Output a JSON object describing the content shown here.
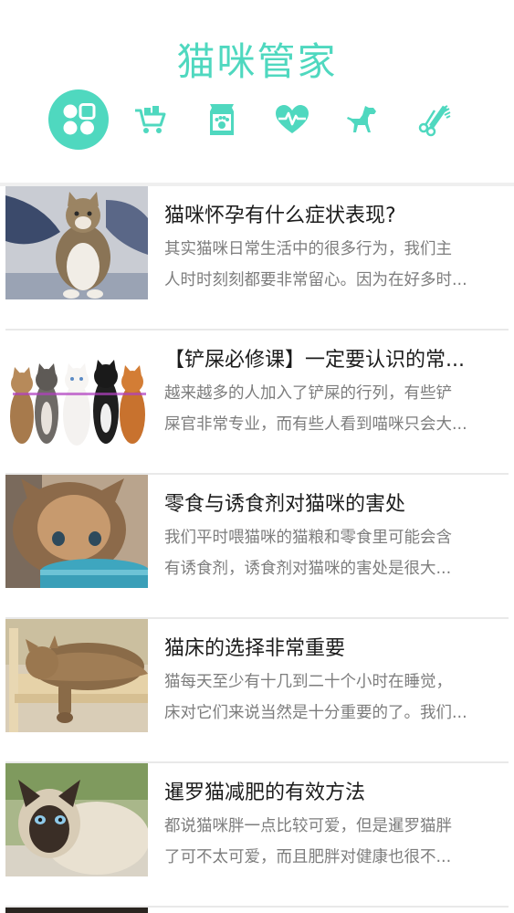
{
  "app": {
    "title": "猫咪管家"
  },
  "categories": [
    {
      "icon": "grid-icon",
      "active": true
    },
    {
      "icon": "cart-icon",
      "active": false
    },
    {
      "icon": "cat-food-icon",
      "active": false
    },
    {
      "icon": "heartbeat-icon",
      "active": false
    },
    {
      "icon": "pet-icon",
      "active": false
    },
    {
      "icon": "grooming-comb-icon",
      "active": false
    }
  ],
  "colors": {
    "accent": "#4fd8bf",
    "title_text": "#1c1c1c",
    "desc_text": "#7d7d7d"
  },
  "articles": [
    {
      "title": "猫咪怀孕有什么症状表现?",
      "desc_line1": "其实猫咪日常生活中的很多行为，我们主",
      "desc_line2": "人时时刻刻都要非常留心。因为在好多时..."
    },
    {
      "title": "【铲屎必修课】一定要认识的常...",
      "desc_line1": "越来越多的人加入了铲屎的行列，有些铲",
      "desc_line2": "屎官非常专业，而有些人看到喵咪只会大..."
    },
    {
      "title": "零食与诱食剂对猫咪的害处",
      "desc_line1": "我们平时喂猫咪的猫粮和零食里可能会含",
      "desc_line2": "有诱食剂，诱食剂对猫咪的害处是很大..."
    },
    {
      "title": "猫床的选择非常重要",
      "desc_line1": "猫每天至少有十几到二十个小时在睡觉，",
      "desc_line2": "床对它们来说当然是十分重要的了。我们..."
    },
    {
      "title": "暹罗猫减肥的有效方法",
      "desc_line1": "都说猫咪胖一点比较可爱，但是暹罗猫胖",
      "desc_line2": "了可不太可爱，而且肥胖对健康也很不..."
    }
  ]
}
